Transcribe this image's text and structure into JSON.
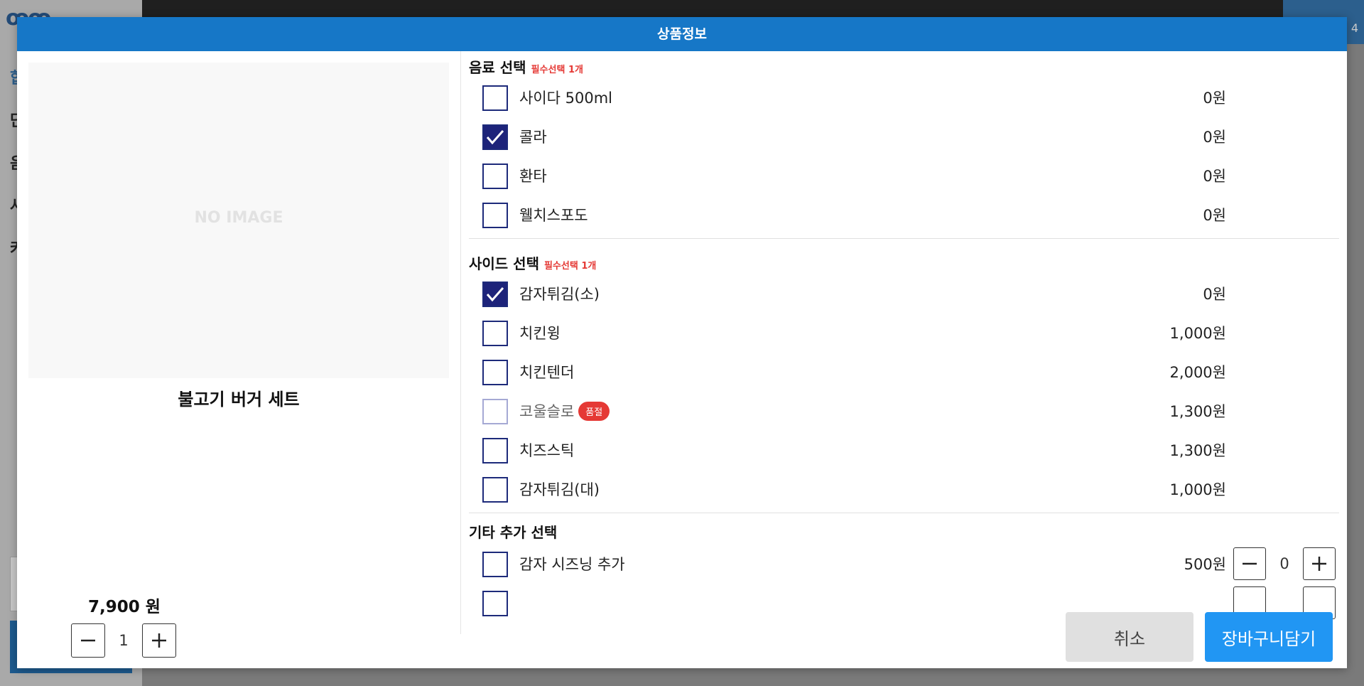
{
  "background": {
    "logo": "ꝏꝏ",
    "nav_items": [
      "합",
      "단",
      "음",
      "사",
      "커"
    ],
    "corner": "4"
  },
  "modal": {
    "title": "상품정보",
    "image_placeholder": "NO IMAGE",
    "product_name": "불고기 버거 세트",
    "product_price": "7,900 원",
    "quantity": "1",
    "cancel_label": "취소",
    "cart_label": "장바구니담기"
  },
  "groups": [
    {
      "title": "음료 선택",
      "required": "필수선택 1개",
      "options": [
        {
          "name": "사이다 500ml",
          "price": "0원",
          "checked": false
        },
        {
          "name": "콜라",
          "price": "0원",
          "checked": true
        },
        {
          "name": "환타",
          "price": "0원",
          "checked": false
        },
        {
          "name": "웰치스포도",
          "price": "0원",
          "checked": false
        }
      ]
    },
    {
      "title": "사이드 선택",
      "required": "필수선택 1개",
      "options": [
        {
          "name": "감자튀김(소)",
          "price": "0원",
          "checked": true
        },
        {
          "name": "치킨윙",
          "price": "1,000원",
          "checked": false
        },
        {
          "name": "치킨텐더",
          "price": "2,000원",
          "checked": false
        },
        {
          "name": "코울슬로",
          "price": "1,300원",
          "checked": false,
          "soldout": "품절"
        },
        {
          "name": "치즈스틱",
          "price": "1,300원",
          "checked": false
        },
        {
          "name": "감자튀김(대)",
          "price": "1,000원",
          "checked": false
        }
      ]
    },
    {
      "title": "기타 추가 선택",
      "required": "",
      "options": [
        {
          "name": "감자 시즈닝 추가",
          "price": "500원",
          "checked": false,
          "qty": "0"
        },
        {
          "name": "",
          "price": "",
          "checked": false,
          "qty": ""
        }
      ]
    }
  ]
}
